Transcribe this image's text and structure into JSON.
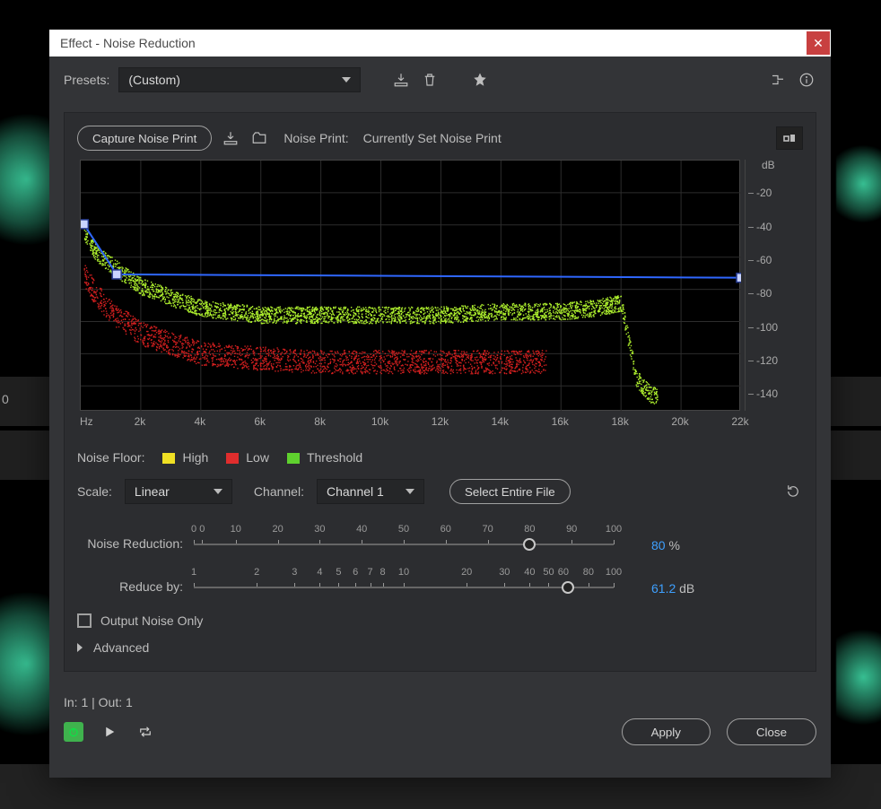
{
  "window": {
    "title": "Effect - Noise Reduction"
  },
  "topbar": {
    "presets_label": "Presets:",
    "presets_value": "(Custom)"
  },
  "noise_print": {
    "capture_label": "Capture Noise Print",
    "status_label": "Noise Print:",
    "status_value": "Currently Set Noise Print"
  },
  "chart": {
    "x_unit": "Hz",
    "x_ticks": [
      "2k",
      "4k",
      "6k",
      "8k",
      "10k",
      "12k",
      "14k",
      "16k",
      "18k",
      "20k",
      "22k"
    ],
    "y_unit": "dB",
    "y_ticks": [
      "-20",
      "-40",
      "-60",
      "-80",
      "-100",
      "-120",
      "-140"
    ]
  },
  "legend": {
    "label": "Noise Floor:",
    "high": "High",
    "low": "Low",
    "threshold": "Threshold"
  },
  "controls": {
    "scale_label": "Scale:",
    "scale_value": "Linear",
    "channel_label": "Channel:",
    "channel_value": "Channel 1",
    "select_file": "Select Entire File"
  },
  "sliders": {
    "nr": {
      "label": "Noise Reduction:",
      "ticks": [
        "0",
        "0",
        "10",
        "20",
        "30",
        "40",
        "50",
        "60",
        "70",
        "80",
        "90",
        "100"
      ],
      "tick_pos": [
        0,
        2,
        10,
        20,
        30,
        40,
        50,
        60,
        70,
        80,
        90,
        100
      ],
      "value_pct": 80,
      "value_display": "80",
      "unit": "%"
    },
    "rb": {
      "label": "Reduce by:",
      "ticks": [
        "1",
        "2",
        "3",
        "4",
        "5",
        "6",
        "7",
        "8",
        "10",
        "20",
        "30",
        "40",
        "50",
        "60",
        "80",
        "100"
      ],
      "tick_pos": [
        0,
        15,
        24,
        30,
        34.5,
        38.5,
        42,
        45,
        50,
        65,
        74,
        80,
        84.5,
        88,
        94,
        100
      ],
      "value_pct": 89,
      "value_display": "61.2",
      "unit": "dB"
    }
  },
  "output_noise_only": "Output Noise Only",
  "advanced_label": "Advanced",
  "footer": {
    "io": "In: 1 | Out: 1",
    "apply": "Apply",
    "close": "Close"
  },
  "chart_data": {
    "type": "line",
    "title": "Noise Print Spectrum",
    "xlabel": "Hz",
    "ylabel": "dB",
    "xlim": [
      0,
      22000
    ],
    "ylim": [
      -150,
      0
    ],
    "series": [
      {
        "name": "Noise Floor High",
        "color": "#aef02e",
        "x": [
          100,
          500,
          1000,
          2000,
          4000,
          6000,
          8000,
          10000,
          12000,
          14000,
          16000,
          17000,
          18000,
          18500,
          19000
        ],
        "values": [
          -42,
          -55,
          -62,
          -75,
          -88,
          -92,
          -92,
          -92,
          -92,
          -90,
          -90,
          -88,
          -85,
          -130,
          -140
        ]
      },
      {
        "name": "Noise Floor Low",
        "color": "#d11f1f",
        "x": [
          100,
          500,
          1000,
          2000,
          4000,
          6000,
          8000,
          10000,
          12000,
          14000,
          15500
        ],
        "values": [
          -68,
          -80,
          -90,
          -103,
          -115,
          -118,
          -120,
          -120,
          -120,
          -120,
          -120
        ]
      },
      {
        "name": "Threshold",
        "color": "#308fff",
        "x": [
          100,
          1200,
          22000
        ],
        "values": [
          -38,
          -68,
          -70
        ]
      }
    ],
    "control_points": [
      {
        "x": 100,
        "y": -38
      },
      {
        "x": 1200,
        "y": -68
      },
      {
        "x": 22000,
        "y": -70
      }
    ]
  }
}
